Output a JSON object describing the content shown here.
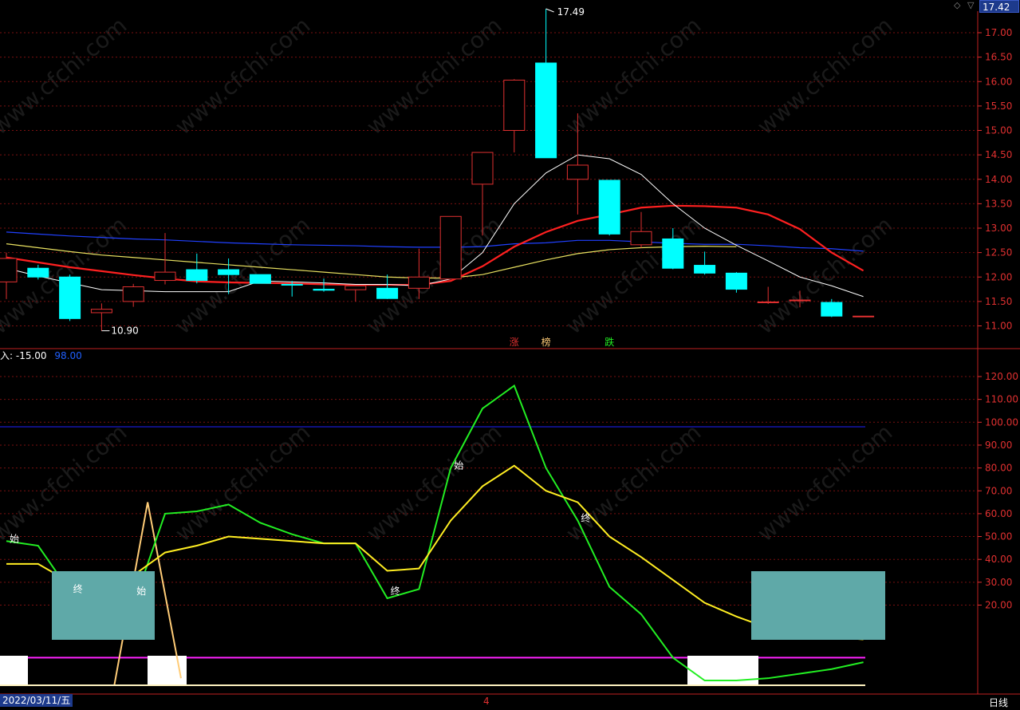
{
  "header": {
    "price_box": "17.42"
  },
  "indicator_label": {
    "prefix": "入: -15.00",
    "value2": "98.00"
  },
  "status_bar": {
    "date": "2022/03/11/五",
    "center": "4",
    "period": "日线"
  },
  "colors": {
    "up": "#e03030",
    "down": "#00ffff",
    "ma5": "#ffffff",
    "ma10": "#ff2020",
    "ma20": "#e8e060",
    "ma60": "#2040ff",
    "green": "#22ee22",
    "yellow": "#ffee22",
    "orange": "#ffcc77",
    "magenta": "#ff22ff",
    "blue_line": "#2020ff",
    "teal_box": "#5fa9a8",
    "grid": "#7a1010"
  },
  "chart_data": [
    {
      "type": "candlestick",
      "title": "",
      "ylim": [
        10.6,
        17.7
      ],
      "yticks": [
        "17.00",
        "16.50",
        "16.00",
        "15.50",
        "15.00",
        "14.50",
        "14.00",
        "13.50",
        "13.00",
        "12.50",
        "12.00",
        "11.50",
        "11.00"
      ],
      "candles": [
        {
          "o": 11.9,
          "c": 12.38,
          "h": 12.5,
          "l": 11.55
        },
        {
          "o": 12.18,
          "c": 12.0,
          "h": 12.25,
          "l": 11.95
        },
        {
          "o": 12.0,
          "c": 11.15,
          "h": 12.05,
          "l": 11.1
        },
        {
          "o": 11.27,
          "c": 11.34,
          "h": 11.46,
          "l": 10.9
        },
        {
          "o": 11.5,
          "c": 11.8,
          "h": 11.86,
          "l": 11.39
        },
        {
          "o": 11.93,
          "c": 12.1,
          "h": 12.9,
          "l": 11.85
        },
        {
          "o": 12.15,
          "c": 11.93,
          "h": 12.48,
          "l": 11.87
        },
        {
          "o": 12.15,
          "c": 12.05,
          "h": 12.38,
          "l": 11.65
        },
        {
          "o": 12.05,
          "c": 11.87,
          "h": 12.05,
          "l": 11.87
        },
        {
          "o": 11.85,
          "c": 11.84,
          "h": 11.92,
          "l": 11.6
        },
        {
          "o": 11.75,
          "c": 11.73,
          "h": 11.97,
          "l": 11.7
        },
        {
          "o": 11.74,
          "c": 11.82,
          "h": 11.84,
          "l": 11.5
        },
        {
          "o": 11.77,
          "c": 11.56,
          "h": 12.05,
          "l": 11.55
        },
        {
          "o": 11.77,
          "c": 12.0,
          "h": 12.58,
          "l": 11.55
        },
        {
          "o": 11.96,
          "c": 13.24,
          "h": 13.24,
          "l": 11.96
        },
        {
          "o": 13.9,
          "c": 14.55,
          "h": 14.55,
          "l": 12.85
        },
        {
          "o": 15.0,
          "c": 16.03,
          "h": 16.05,
          "l": 14.55
        },
        {
          "o": 16.38,
          "c": 14.44,
          "h": 17.49,
          "l": 14.44
        },
        {
          "o": 14.0,
          "c": 14.29,
          "h": 15.35,
          "l": 13.28
        },
        {
          "o": 13.98,
          "c": 12.88,
          "h": 13.98,
          "l": 12.85
        },
        {
          "o": 12.66,
          "c": 12.93,
          "h": 13.33,
          "l": 12.6
        },
        {
          "o": 12.78,
          "c": 12.18,
          "h": 13.0,
          "l": 12.16
        },
        {
          "o": 12.24,
          "c": 12.08,
          "h": 12.52,
          "l": 12.05
        },
        {
          "o": 12.08,
          "c": 11.75,
          "h": 12.1,
          "l": 11.68
        },
        {
          "o": 11.49,
          "c": 11.49,
          "h": 11.8,
          "l": 11.45
        },
        {
          "o": 11.53,
          "c": 11.53,
          "h": 11.72,
          "l": 11.38
        },
        {
          "o": 11.48,
          "c": 11.2,
          "h": 11.55,
          "l": 11.18
        },
        {
          "o": 11.2,
          "c": 11.2,
          "h": 11.2,
          "l": 11.2
        }
      ],
      "ma5": [
        12.18,
        12.02,
        11.88,
        11.74,
        11.72,
        11.7,
        11.7,
        11.7,
        11.92,
        11.9,
        11.88,
        11.85,
        11.85,
        11.82,
        11.96,
        12.5,
        13.5,
        14.13,
        14.5,
        14.42,
        14.1,
        13.5,
        13.0,
        12.65,
        12.33,
        12.0,
        11.82,
        11.6
      ],
      "ma10": [
        12.4,
        12.3,
        12.2,
        12.12,
        12.04,
        11.97,
        11.91,
        11.89,
        11.88,
        11.87,
        11.85,
        11.84,
        11.84,
        11.84,
        11.92,
        12.22,
        12.62,
        12.92,
        13.15,
        13.28,
        13.42,
        13.46,
        13.45,
        13.42,
        13.28,
        12.98,
        12.5,
        12.13
      ],
      "ma20": [
        12.68,
        12.6,
        12.52,
        12.45,
        12.4,
        12.35,
        12.3,
        12.25,
        12.2,
        12.15,
        12.1,
        12.05,
        12.0,
        11.98,
        11.98,
        12.05,
        12.2,
        12.35,
        12.48,
        12.56,
        12.6,
        12.62,
        12.63,
        12.62
      ],
      "ma60": [
        12.92,
        12.88,
        12.84,
        12.81,
        12.78,
        12.76,
        12.73,
        12.7,
        12.68,
        12.66,
        12.65,
        12.64,
        12.62,
        12.61,
        12.61,
        12.62,
        12.68,
        12.7,
        12.75,
        12.75,
        12.72,
        12.69,
        12.67,
        12.67,
        12.64,
        12.6,
        12.58,
        12.53
      ],
      "annotations": {
        "high": "17.49",
        "low": "10.90"
      },
      "markers": [
        "涨",
        "榜",
        "跌"
      ]
    },
    {
      "type": "line",
      "title": "",
      "ylim": [
        -15,
        125
      ],
      "yticks": [
        "120.00",
        "110.00",
        "100.00",
        "90.00",
        "80.00",
        "70.00",
        "60.00",
        "50.00",
        "40.00",
        "30.00",
        "20.00"
      ],
      "reference_line": 98,
      "green": [
        48,
        46,
        26,
        19,
        20,
        60,
        61,
        64,
        56,
        51,
        47,
        47,
        23,
        27,
        80,
        106,
        116,
        80,
        57,
        28,
        16,
        -3,
        -13,
        -13,
        -12,
        -10,
        -8,
        -5
      ],
      "yellow": [
        38,
        38,
        30,
        32,
        33,
        43,
        46,
        50,
        49,
        48,
        47,
        47,
        35,
        36,
        57,
        72,
        81,
        70,
        65,
        50,
        41,
        31,
        21,
        15,
        10,
        8,
        6,
        5
      ],
      "orange_spike": {
        "x": [
          3.0,
          4.0,
          5.0
        ],
        "y": [
          -15,
          65,
          -12
        ]
      },
      "labels": [
        {
          "text": "始",
          "i": 0
        },
        {
          "text": "终",
          "i": 2
        },
        {
          "text": "始",
          "i": 4
        },
        {
          "text": "终",
          "i": 12
        },
        {
          "text": "始",
          "i": 14
        },
        {
          "text": "终",
          "i": 18
        }
      ]
    }
  ]
}
